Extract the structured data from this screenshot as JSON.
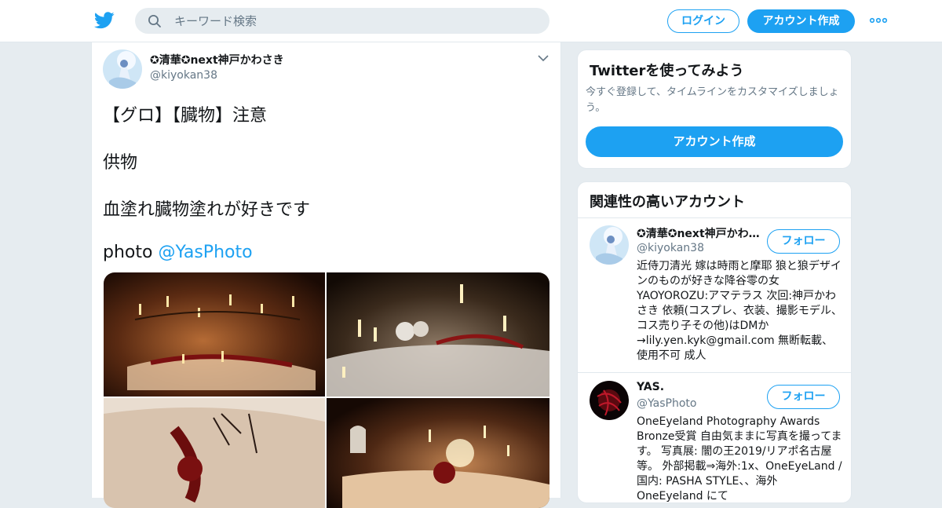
{
  "header": {
    "logo_icon": "twitter-bird-icon",
    "search": {
      "placeholder": "キーワード検索",
      "icon": "search-icon"
    },
    "login_label": "ログイン",
    "signup_label": "アカウント作成",
    "more_icon": "more-dots-icon",
    "accent_color": "#1da1f2"
  },
  "tweet": {
    "author_name": "✪清華✪next神戸かわさき",
    "author_handle": "@kiyokan38",
    "lines": [
      "【グロ】【臓物】注意",
      "供物",
      "血塗れ臓物塗れが好きです"
    ],
    "photo_prefix": "photo ",
    "photo_mention": "@YasPhoto",
    "menu_icon": "chevron-down-icon",
    "media_count": 4
  },
  "sidebar": {
    "signup_card": {
      "title": "Twitterを使ってみよう",
      "subtitle": "今すぐ登録して、タイムラインをカスタマイズしましょう。",
      "button": "アカウント作成"
    },
    "related": {
      "title": "関連性の高いアカウント",
      "accounts": [
        {
          "name": "✪清華✪next神戸かわさき",
          "handle": "@kiyokan38",
          "follow": "フォロー",
          "bio": "近侍刀清光 嫁は時雨と摩耶 狼と狼デザインのものが好きな降谷零の女 YAOYOROZU:アマテラス 次回:神戸かわさき 依頼(コスプレ、衣装、撮影モデル、コス売り子その他)はDMか→lily.yen.kyk@gmail.com 無断転載、使用不可 成人"
        },
        {
          "name": "YAS.",
          "handle": "@YasPhoto",
          "follow": "フォロー",
          "bio": "OneEyeland Photography Awards Bronze受賞 自由気ままに写真を撮ってます。 写真展: 闇の王2019/リアポ名古屋等。 外部掲載⇒海外:1x、OneEyeLand / 国内: PASHA STYLE、、海外OneEyeland にて"
        }
      ]
    }
  }
}
